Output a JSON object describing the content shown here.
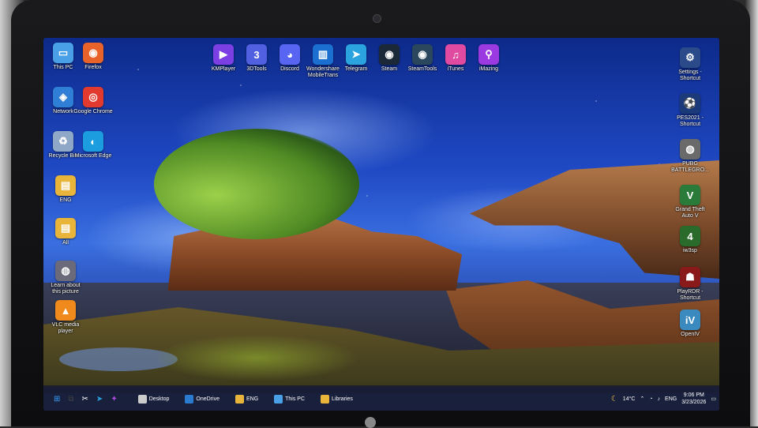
{
  "desktop_left": [
    {
      "label": "This PC",
      "color": "#4aa0e6",
      "glyph": "▭"
    },
    {
      "label": "Firefox",
      "color": "#e8632a",
      "glyph": "◉"
    },
    {
      "label": "Network",
      "color": "#2f7fd6",
      "glyph": "◈"
    },
    {
      "label": "Google Chrome",
      "color": "#e23a2e",
      "glyph": "◎"
    },
    {
      "label": "Recycle Bin",
      "color": "#8fa8c8",
      "glyph": "♻"
    },
    {
      "label": "Microsoft Edge",
      "color": "#1b9de0",
      "glyph": "◐"
    },
    {
      "label": "ENG",
      "color": "#e8b53a",
      "glyph": "▤"
    },
    {
      "label": "All",
      "color": "#e8b53a",
      "glyph": "▤"
    },
    {
      "label": "Learn about this picture",
      "color": "#6a6a7a",
      "glyph": "◍"
    },
    {
      "label": "VLC media player",
      "color": "#f08a1c",
      "glyph": "▲"
    }
  ],
  "desktop_top": [
    {
      "label": "KMPlayer",
      "color": "#7b3fe4",
      "glyph": "▶"
    },
    {
      "label": "3DTools",
      "color": "#5060e0",
      "glyph": "3"
    },
    {
      "label": "Discord",
      "color": "#5865f2",
      "glyph": "◕"
    },
    {
      "label": "Wondershare MobileTrans",
      "color": "#1a6fd0",
      "glyph": "▥"
    },
    {
      "label": "Telegram",
      "color": "#2aa3de",
      "glyph": "➤"
    },
    {
      "label": "Steam",
      "color": "#1b2838",
      "glyph": "◉"
    },
    {
      "label": "SteamTools",
      "color": "#2a475e",
      "glyph": "◉"
    },
    {
      "label": "iTunes",
      "color": "#e04aa0",
      "glyph": "♫"
    },
    {
      "label": "iMazing",
      "color": "#9a3ae0",
      "glyph": "⚲"
    }
  ],
  "desktop_right": [
    {
      "label": "Settings - Shortcut",
      "color": "#2a4a8a",
      "glyph": "⚙"
    },
    {
      "label": "PES2021 - Shortcut",
      "color": "#1a3a7a",
      "glyph": "⚽"
    },
    {
      "label": "PUBG BATTLEGRO...",
      "color": "#6a6a6a",
      "glyph": "◍"
    },
    {
      "label": "Grand Theft Auto V",
      "color": "#2a7a3a",
      "glyph": "V"
    },
    {
      "label": "iw3sp",
      "color": "#2a6a2a",
      "glyph": "4"
    },
    {
      "label": "PlayRDR - Shortcut",
      "color": "#8a1a1a",
      "glyph": "☗"
    },
    {
      "label": "OpenIV",
      "color": "#3a8ac0",
      "glyph": "iV"
    }
  ],
  "taskbar": {
    "pinned": [
      {
        "name": "start",
        "color": "#3aa0ff",
        "glyph": "⊞"
      },
      {
        "name": "task-view",
        "color": "#444",
        "glyph": "⧉"
      },
      {
        "name": "capcut",
        "color": "#111",
        "glyph": "✂"
      },
      {
        "name": "telegram",
        "color": "#2aa3de",
        "glyph": "➤"
      },
      {
        "name": "copilot",
        "color": "#b04ae0",
        "glyph": "✦"
      }
    ],
    "windows": [
      {
        "label": "Desktop",
        "color": "#ccc"
      },
      {
        "label": "OneDrive",
        "color": "#2a7ad0"
      },
      {
        "label": "ENG",
        "color": "#e8b53a"
      },
      {
        "label": "This PC",
        "color": "#4aa0e6"
      },
      {
        "label": "Libraries",
        "color": "#e8b53a"
      }
    ],
    "weather": "14°C",
    "lang": "ENG",
    "time": "9:06 PM",
    "date": "3/23/2026"
  }
}
